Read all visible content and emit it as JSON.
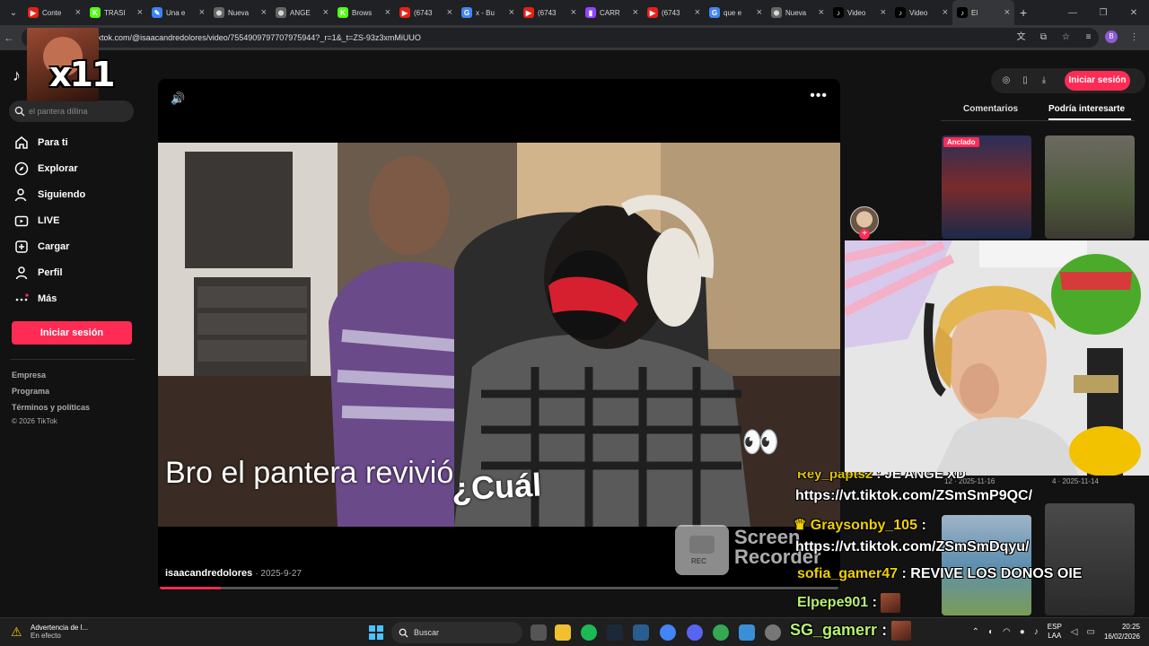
{
  "browser": {
    "tabs": [
      {
        "title": "Conte",
        "fav_color": "#e62117",
        "fav": "▶"
      },
      {
        "title": "TRASI",
        "fav_color": "#53fc18",
        "fav": "K"
      },
      {
        "title": "Una e",
        "fav_color": "#3b82f6",
        "fav": "✎"
      },
      {
        "title": "Nueva",
        "fav_color": "#666666",
        "fav": "⊕"
      },
      {
        "title": "ANGE",
        "fav_color": "#666666",
        "fav": "⊕"
      },
      {
        "title": "Brows",
        "fav_color": "#53fc18",
        "fav": "K"
      },
      {
        "title": "(6743",
        "fav_color": "#e62117",
        "fav": "▶"
      },
      {
        "title": "x - Bu",
        "fav_color": "#4285f4",
        "fav": "G"
      },
      {
        "title": "(6743",
        "fav_color": "#e62117",
        "fav": "▶"
      },
      {
        "title": "CARR",
        "fav_color": "#9146ff",
        "fav": "▮"
      },
      {
        "title": "(6743",
        "fav_color": "#e62117",
        "fav": "▶"
      },
      {
        "title": "que e",
        "fav_color": "#4285f4",
        "fav": "G"
      },
      {
        "title": "Nueva",
        "fav_color": "#666666",
        "fav": "⊕"
      },
      {
        "title": "Video",
        "fav_color": "#000000",
        "fav": "♪"
      },
      {
        "title": "Video",
        "fav_color": "#000000",
        "fav": "♪"
      },
      {
        "title": "El",
        "fav_color": "#000000",
        "fav": "♪"
      }
    ],
    "url": "tiktok.com/@isaacandredolores/video/7554909797707975944?_r=1&_t=ZS-93z3xmMiUUO",
    "profile_initial": "B"
  },
  "meme_overlay_text": "x11",
  "sidebar": {
    "logo": "♪",
    "search_placeholder": "el pantera dillina",
    "nav": [
      {
        "label": "Para ti",
        "icon": "home-icon"
      },
      {
        "label": "Explorar",
        "icon": "compass-icon"
      },
      {
        "label": "Siguiendo",
        "icon": "following-icon"
      },
      {
        "label": "LIVE",
        "icon": "live-icon"
      },
      {
        "label": "Cargar",
        "icon": "upload-icon"
      },
      {
        "label": "Perfil",
        "icon": "profile-icon"
      },
      {
        "label": "Más",
        "icon": "more-icon"
      }
    ],
    "login": "Iniciar sesión",
    "footer": [
      "Empresa",
      "Programa",
      "Términos y políticas"
    ],
    "copyright": "© 2026 TikTok"
  },
  "video": {
    "caption_line1": "Bro el pantera revivió",
    "caption_line2": "¿Cuál",
    "creator": "isaacandredolores",
    "date": "2025-9-27",
    "progress": 0.09,
    "eyes_emoji": "👀"
  },
  "recorder": {
    "badge": "REC",
    "label_1": "Screen",
    "label_2": "Recorder"
  },
  "right_panel": {
    "login": "Iniciar sesión",
    "tab_comments": "Comentarios",
    "tab_interest": "Podría interesarte",
    "pinned": "Anclado",
    "meta_1": "12 · 2025-11-16",
    "meta_2": "4 · 2025-11-14"
  },
  "chat": [
    {
      "user": "Rey_papts2",
      "text": ": JE ANGE XD",
      "url": ""
    },
    {
      "user": "",
      "text": "",
      "url": "https://vt.tiktok.com/ZSmSmP9QC/"
    },
    {
      "user": "Graysonby_105",
      "text": ":",
      "url": ""
    },
    {
      "user": "",
      "text": "",
      "url": "https://vt.tiktok.com/ZSmSmDqyu/"
    },
    {
      "user": "sofia_gamer47",
      "text": ": REVIVE LOS DONOS OIE",
      "url": ""
    },
    {
      "user": "Elpepe901",
      "text": ":",
      "url": ""
    },
    {
      "user": "SG_gamerr",
      "text": ":",
      "url": ""
    }
  ],
  "taskbar": {
    "warning_title": "Advertencia de l...",
    "warning_sub": "En efecto",
    "search": "Buscar",
    "lang_1": "ESP",
    "lang_2": "LAA",
    "time": "20:25",
    "date": "16/02/2026"
  }
}
